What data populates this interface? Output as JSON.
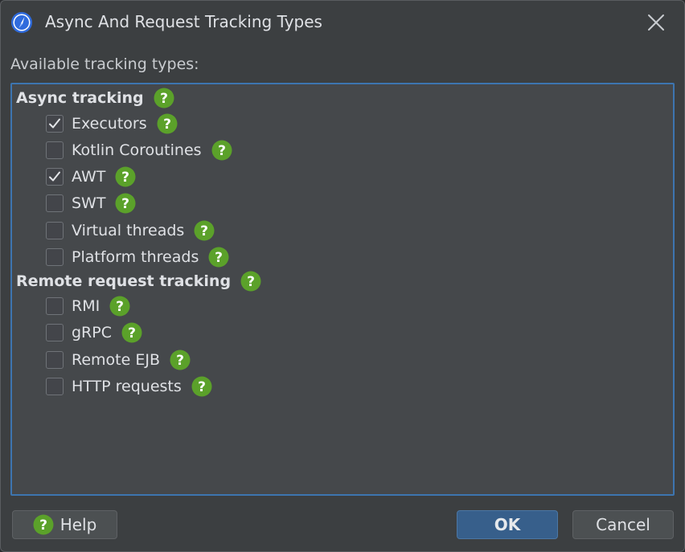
{
  "window": {
    "title": "Async And Request Tracking Types"
  },
  "section_label": "Available tracking types:",
  "groups": [
    {
      "label": "Async tracking",
      "items": [
        {
          "label": "Executors",
          "checked": true
        },
        {
          "label": "Kotlin Coroutines",
          "checked": false
        },
        {
          "label": "AWT",
          "checked": true
        },
        {
          "label": "SWT",
          "checked": false
        },
        {
          "label": "Virtual threads",
          "checked": false
        },
        {
          "label": "Platform threads",
          "checked": false
        }
      ]
    },
    {
      "label": "Remote request tracking",
      "items": [
        {
          "label": "RMI",
          "checked": false
        },
        {
          "label": "gRPC",
          "checked": false
        },
        {
          "label": "Remote EJB",
          "checked": false
        },
        {
          "label": "HTTP requests",
          "checked": false
        }
      ]
    }
  ],
  "buttons": {
    "help": "Help",
    "ok": "OK",
    "cancel": "Cancel"
  },
  "colors": {
    "accent": "#3d75b0",
    "help_icon": "#5ba12a",
    "ok_button": "#375f8b",
    "background": "#3c3f41"
  },
  "icons": {
    "app": "compass-icon",
    "close": "close-icon",
    "help": "help-icon",
    "checkbox_check": "check-icon"
  }
}
